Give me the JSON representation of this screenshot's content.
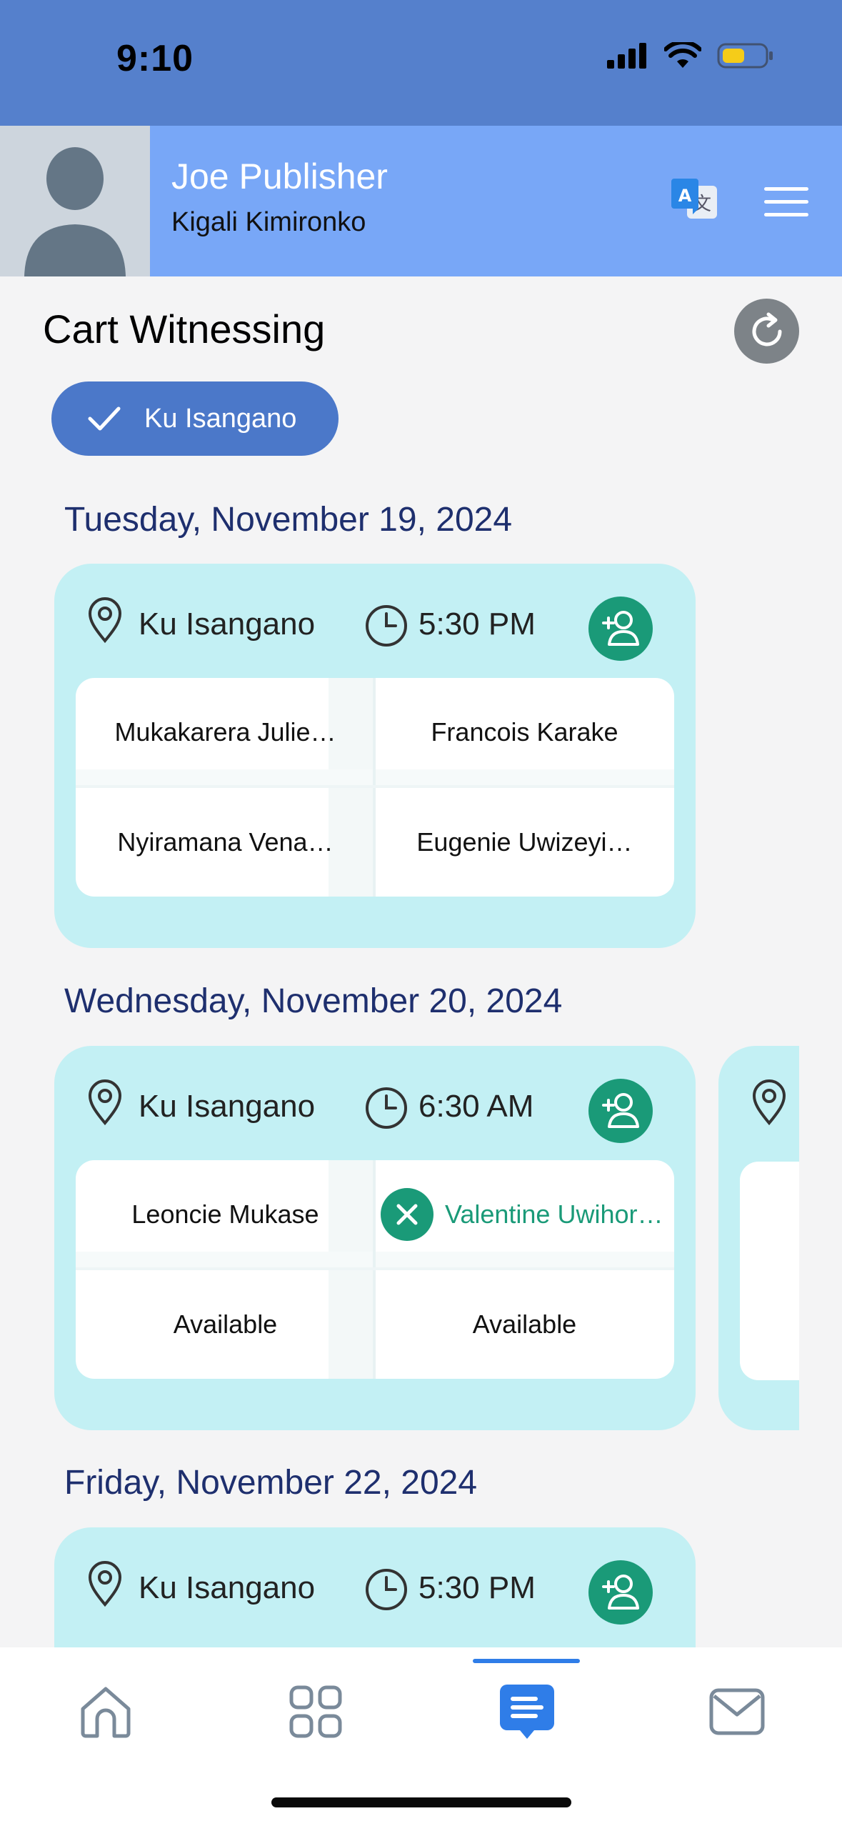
{
  "status_bar": {
    "time": "9:10"
  },
  "header": {
    "user_name": "Joe Publisher",
    "user_location": "Kigali Kimironko"
  },
  "page": {
    "title": "Cart Witnessing",
    "filter_label": "Ku Isangano"
  },
  "schedule": [
    {
      "date": "Tuesday, November 19, 2024",
      "location": "Ku Isangano",
      "time": "5:30 PM",
      "slots": [
        "Mukakarera Julie…",
        "Francois Karake",
        "Nyiramana Vena…",
        "Eugenie  Uwizeyi…"
      ]
    },
    {
      "date": "Wednesday, November 20, 2024",
      "location": "Ku Isangano",
      "time": "6:30 AM",
      "slots": [
        "Leoncie Mukase",
        "Valentine Uwihor…",
        "Available",
        "Available"
      ]
    },
    {
      "date": "Friday, November 22, 2024",
      "location": "Ku Isangano",
      "time": "5:30 PM",
      "slots": []
    }
  ],
  "colors": {
    "status_bar": "#5580cc",
    "header": "#78a7f7",
    "chip": "#4b78c9",
    "card": "#c3f0f4",
    "accent_green": "#1a9a78",
    "date_text": "#1e2f6e",
    "nav_active": "#2f7de8"
  },
  "nav": {
    "items": [
      "home-icon",
      "grid-icon",
      "schedule-icon",
      "mail-icon"
    ],
    "active": "schedule-icon"
  }
}
